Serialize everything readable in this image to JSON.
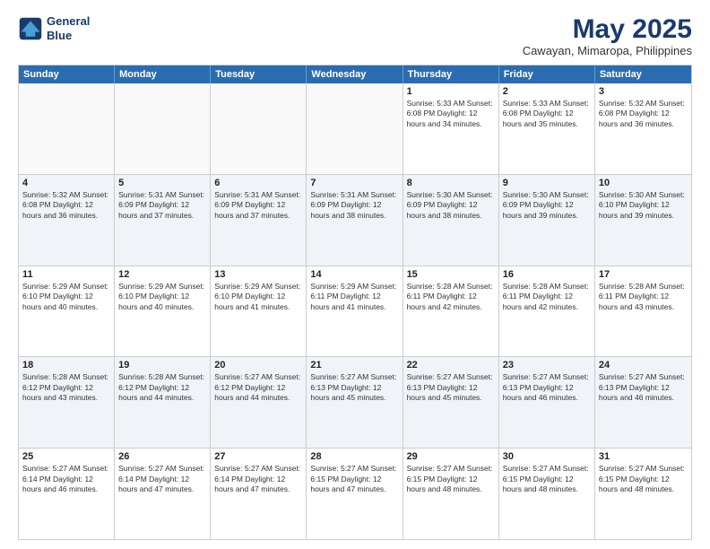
{
  "logo": {
    "line1": "General",
    "line2": "Blue"
  },
  "title": "May 2025",
  "subtitle": "Cawayan, Mimaropa, Philippines",
  "dayHeaders": [
    "Sunday",
    "Monday",
    "Tuesday",
    "Wednesday",
    "Thursday",
    "Friday",
    "Saturday"
  ],
  "weeks": [
    [
      {
        "num": "",
        "info": "",
        "empty": true
      },
      {
        "num": "",
        "info": "",
        "empty": true
      },
      {
        "num": "",
        "info": "",
        "empty": true
      },
      {
        "num": "",
        "info": "",
        "empty": true
      },
      {
        "num": "1",
        "info": "Sunrise: 5:33 AM\nSunset: 6:08 PM\nDaylight: 12 hours\nand 34 minutes."
      },
      {
        "num": "2",
        "info": "Sunrise: 5:33 AM\nSunset: 6:08 PM\nDaylight: 12 hours\nand 35 minutes."
      },
      {
        "num": "3",
        "info": "Sunrise: 5:32 AM\nSunset: 6:08 PM\nDaylight: 12 hours\nand 36 minutes."
      }
    ],
    [
      {
        "num": "4",
        "info": "Sunrise: 5:32 AM\nSunset: 6:08 PM\nDaylight: 12 hours\nand 36 minutes."
      },
      {
        "num": "5",
        "info": "Sunrise: 5:31 AM\nSunset: 6:09 PM\nDaylight: 12 hours\nand 37 minutes."
      },
      {
        "num": "6",
        "info": "Sunrise: 5:31 AM\nSunset: 6:09 PM\nDaylight: 12 hours\nand 37 minutes."
      },
      {
        "num": "7",
        "info": "Sunrise: 5:31 AM\nSunset: 6:09 PM\nDaylight: 12 hours\nand 38 minutes."
      },
      {
        "num": "8",
        "info": "Sunrise: 5:30 AM\nSunset: 6:09 PM\nDaylight: 12 hours\nand 38 minutes."
      },
      {
        "num": "9",
        "info": "Sunrise: 5:30 AM\nSunset: 6:09 PM\nDaylight: 12 hours\nand 39 minutes."
      },
      {
        "num": "10",
        "info": "Sunrise: 5:30 AM\nSunset: 6:10 PM\nDaylight: 12 hours\nand 39 minutes."
      }
    ],
    [
      {
        "num": "11",
        "info": "Sunrise: 5:29 AM\nSunset: 6:10 PM\nDaylight: 12 hours\nand 40 minutes."
      },
      {
        "num": "12",
        "info": "Sunrise: 5:29 AM\nSunset: 6:10 PM\nDaylight: 12 hours\nand 40 minutes."
      },
      {
        "num": "13",
        "info": "Sunrise: 5:29 AM\nSunset: 6:10 PM\nDaylight: 12 hours\nand 41 minutes."
      },
      {
        "num": "14",
        "info": "Sunrise: 5:29 AM\nSunset: 6:11 PM\nDaylight: 12 hours\nand 41 minutes."
      },
      {
        "num": "15",
        "info": "Sunrise: 5:28 AM\nSunset: 6:11 PM\nDaylight: 12 hours\nand 42 minutes."
      },
      {
        "num": "16",
        "info": "Sunrise: 5:28 AM\nSunset: 6:11 PM\nDaylight: 12 hours\nand 42 minutes."
      },
      {
        "num": "17",
        "info": "Sunrise: 5:28 AM\nSunset: 6:11 PM\nDaylight: 12 hours\nand 43 minutes."
      }
    ],
    [
      {
        "num": "18",
        "info": "Sunrise: 5:28 AM\nSunset: 6:12 PM\nDaylight: 12 hours\nand 43 minutes."
      },
      {
        "num": "19",
        "info": "Sunrise: 5:28 AM\nSunset: 6:12 PM\nDaylight: 12 hours\nand 44 minutes."
      },
      {
        "num": "20",
        "info": "Sunrise: 5:27 AM\nSunset: 6:12 PM\nDaylight: 12 hours\nand 44 minutes."
      },
      {
        "num": "21",
        "info": "Sunrise: 5:27 AM\nSunset: 6:13 PM\nDaylight: 12 hours\nand 45 minutes."
      },
      {
        "num": "22",
        "info": "Sunrise: 5:27 AM\nSunset: 6:13 PM\nDaylight: 12 hours\nand 45 minutes."
      },
      {
        "num": "23",
        "info": "Sunrise: 5:27 AM\nSunset: 6:13 PM\nDaylight: 12 hours\nand 46 minutes."
      },
      {
        "num": "24",
        "info": "Sunrise: 5:27 AM\nSunset: 6:13 PM\nDaylight: 12 hours\nand 46 minutes."
      }
    ],
    [
      {
        "num": "25",
        "info": "Sunrise: 5:27 AM\nSunset: 6:14 PM\nDaylight: 12 hours\nand 46 minutes."
      },
      {
        "num": "26",
        "info": "Sunrise: 5:27 AM\nSunset: 6:14 PM\nDaylight: 12 hours\nand 47 minutes."
      },
      {
        "num": "27",
        "info": "Sunrise: 5:27 AM\nSunset: 6:14 PM\nDaylight: 12 hours\nand 47 minutes."
      },
      {
        "num": "28",
        "info": "Sunrise: 5:27 AM\nSunset: 6:15 PM\nDaylight: 12 hours\nand 47 minutes."
      },
      {
        "num": "29",
        "info": "Sunrise: 5:27 AM\nSunset: 6:15 PM\nDaylight: 12 hours\nand 48 minutes."
      },
      {
        "num": "30",
        "info": "Sunrise: 5:27 AM\nSunset: 6:15 PM\nDaylight: 12 hours\nand 48 minutes."
      },
      {
        "num": "31",
        "info": "Sunrise: 5:27 AM\nSunset: 6:15 PM\nDaylight: 12 hours\nand 48 minutes."
      }
    ]
  ]
}
